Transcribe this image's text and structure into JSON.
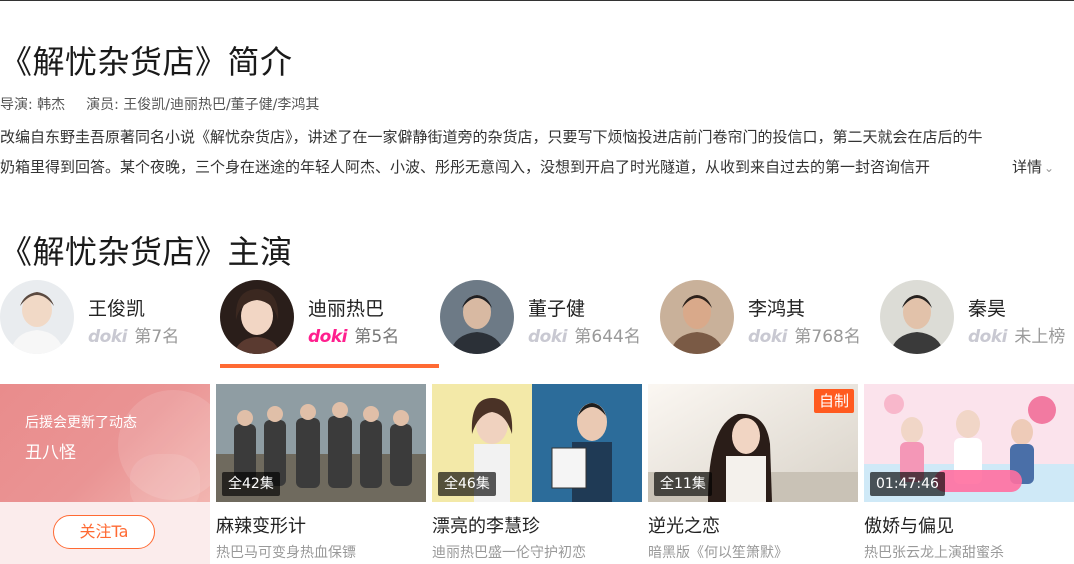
{
  "intro": {
    "title": "《解忧杂货店》简介",
    "director_label": "导演:",
    "director": "韩杰",
    "cast_label": "演员:",
    "cast": "王俊凯/迪丽热巴/董子健/李鸿其",
    "desc_line1": "改编自东野圭吾原著同名小说《解忧杂货店》，讲述了在一家僻静街道旁的杂货店，只要写下烦恼投进店前门卷帘门的投信口，第二天就会在店后的牛",
    "desc_line2": "奶箱里得到回答。某个夜晚，三个身在迷途的年轻人阿杰、小波、彤彤无意闯入，没想到开启了时光隧道，从收到来自过去的第一封咨询信开",
    "more": "详情"
  },
  "cast_section": {
    "title": "《解忧杂货店》主演",
    "doki_label": "doki",
    "actors": [
      {
        "name": "王俊凯",
        "rank": "第7名"
      },
      {
        "name": "迪丽热巴",
        "rank": "第5名"
      },
      {
        "name": "董子健",
        "rank": "第644名"
      },
      {
        "name": "李鸿其",
        "rank": "第768名"
      },
      {
        "name": "秦昊",
        "rank": "未上榜"
      }
    ]
  },
  "fan_card": {
    "line1": "后援会更新了动态",
    "line2": "丑八怪",
    "button": "关注Ta"
  },
  "shows": [
    {
      "title": "麻辣变形计",
      "subtitle": "热巴马可变身热血保镖",
      "badge": "全42集"
    },
    {
      "title": "漂亮的李慧珍",
      "subtitle": "迪丽热巴盛一伦守护初恋",
      "badge": "全46集"
    },
    {
      "title": "逆光之恋",
      "subtitle": "暗黑版《何以笙箫默》",
      "badge": "全11集",
      "tag": "自制"
    },
    {
      "title": "傲娇与偏见",
      "subtitle": "热巴张云龙上演甜蜜杀",
      "badge": "01:47:46"
    }
  ],
  "colors": {
    "accent": "#ff6a33",
    "doki_active": "#ff1f8e",
    "doki_inactive": "#c9c9d2"
  }
}
